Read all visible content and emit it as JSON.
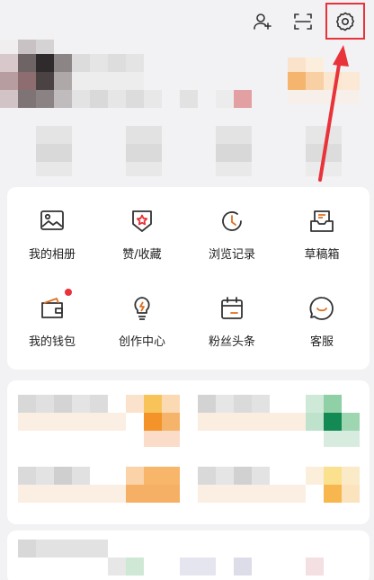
{
  "topbar": {
    "icons": [
      "add-user-icon",
      "scan-icon",
      "settings-icon"
    ]
  },
  "menu": {
    "items": [
      {
        "label": "我的相册",
        "icon": "photo-album-icon"
      },
      {
        "label": "赞/收藏",
        "icon": "like-favorite-icon"
      },
      {
        "label": "浏览记录",
        "icon": "history-icon"
      },
      {
        "label": "草稿箱",
        "icon": "drafts-icon"
      },
      {
        "label": "我的钱包",
        "icon": "wallet-icon",
        "badge": true
      },
      {
        "label": "创作中心",
        "icon": "lightbulb-icon"
      },
      {
        "label": "粉丝头条",
        "icon": "calendar-icon"
      },
      {
        "label": "客服",
        "icon": "customer-service-icon"
      }
    ]
  },
  "colors": {
    "accent_red": "#e8333a",
    "icon_stroke": "#333333",
    "background": "#f2f2f4"
  }
}
